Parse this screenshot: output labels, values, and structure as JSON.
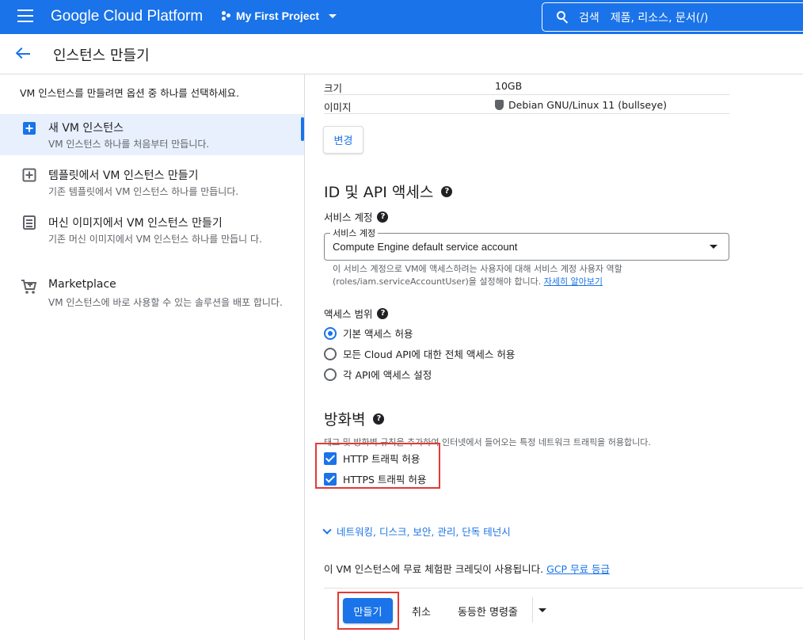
{
  "topbar": {
    "brand": "Google Cloud Platform",
    "project": "My First Project",
    "search_label": "검색",
    "search_placeholder": "제품, 리소스, 문서(/)"
  },
  "header": {
    "title": "인스턴스 만들기"
  },
  "left_panel": {
    "intro": "VM 인스턴스를 만들려면 옵션 중 하나를 선택하세요.",
    "options": [
      {
        "title": "새 VM 인스턴스",
        "desc": "VM 인스턴스 하나를 처음부터 만듭니다.",
        "icon": "add-box-icon",
        "selected": true
      },
      {
        "title": "템플릿에서 VM 인스턴스 만들기",
        "desc": "기존 템플릿에서 VM 인스턴스 하나를 만듭니다.",
        "icon": "template-icon",
        "selected": false
      },
      {
        "title": "머신 이미지에서 VM 인스턴스 만들기",
        "desc": "기존 머신 이미지에서 VM 인스턴스 하나를 만듭니 다.",
        "icon": "machine-image-icon",
        "selected": false
      },
      {
        "title": "Marketplace",
        "desc": "VM 인스턴스에 바로 사용할 수 있는 솔루션을 배포 합니다.",
        "icon": "cart-icon",
        "selected": false
      }
    ]
  },
  "boot_disk": {
    "size_label": "크기",
    "size_value": "10GB",
    "image_label": "이미지",
    "image_value": "Debian GNU/Linux 11 (bullseye)",
    "change_button": "변경"
  },
  "identity": {
    "title": "ID 및 API 액세스",
    "service_account_label": "서비스 계정",
    "select_float_label": "서비스 계정",
    "select_value": "Compute Engine default service account",
    "hint": "이 서비스 계정으로 VM에 액세스하려는 사용자에 대해 서비스 계정 사용자 역할(roles/iam.serviceAccountUser)을 설정해야 합니다.",
    "hint_link": "자세히 알아보기",
    "access_scope_label": "액세스 범위",
    "scopes": [
      {
        "label": "기본 액세스 허용",
        "selected": true
      },
      {
        "label": "모든 Cloud API에 대한 전체 액세스 허용",
        "selected": false
      },
      {
        "label": "각 API에 액세스 설정",
        "selected": false
      }
    ]
  },
  "firewall": {
    "title": "방화벽",
    "desc": "태그 및 방화벽 규칙을 추가하여 인터넷에서 들어오는 특정 네트워크 트래픽을 허용합니다.",
    "http_label": "HTTP 트래픽 허용",
    "https_label": "HTTPS 트래픽 허용",
    "http_checked": true,
    "https_checked": true
  },
  "more": {
    "label": "네트워킹, 디스크, 보안, 관리, 단독 테넌시"
  },
  "credit": {
    "text": "이 VM 인스턴스에 무료 체험판 크레딧이 사용됩니다.",
    "link": "GCP 무료 등급"
  },
  "footer": {
    "create": "만들기",
    "cancel": "취소",
    "equivalent": "동등한 명령줄"
  },
  "colors": {
    "accent": "#1a73e8",
    "highlight": "#e53935"
  }
}
